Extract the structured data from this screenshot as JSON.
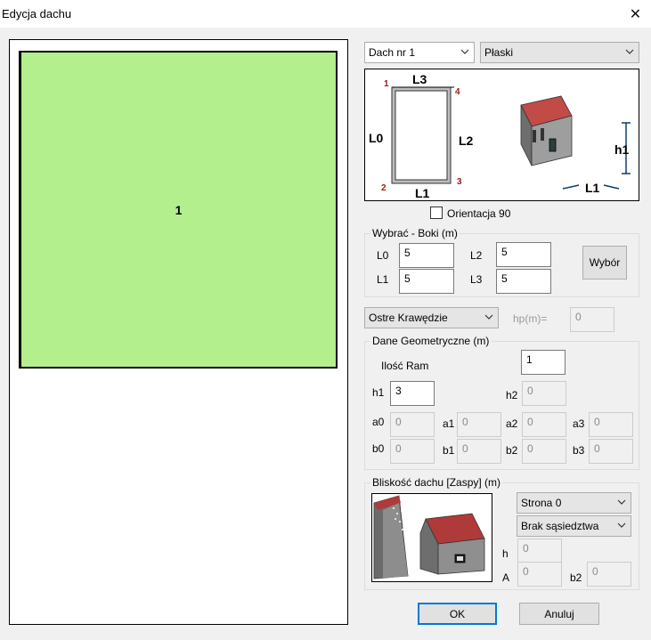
{
  "window": {
    "title": "Edycja dachu",
    "close_glyph": "✕"
  },
  "canvas": {
    "roof_label": "1"
  },
  "top": {
    "roof_select": "Dach nr 1",
    "type_select": "Płaski"
  },
  "diagram": {
    "n1": "1",
    "n2": "2",
    "n3": "3",
    "n4": "4",
    "L0": "L0",
    "L1": "L1",
    "L2": "L2",
    "L3": "L3",
    "h1": "h1",
    "L1_3d": "L1"
  },
  "orientation": {
    "label": "Orientacja 90",
    "checked": false
  },
  "sides": {
    "legend": "Wybrać - Boki (m)",
    "L0_label": "L0",
    "L0_value": "5",
    "L1_label": "L1",
    "L1_value": "5",
    "L2_label": "L2",
    "L2_value": "5",
    "L3_label": "L3",
    "L3_value": "5",
    "select_button": "Wybór"
  },
  "edges": {
    "select": "Ostre Krawędzie",
    "hp_label": "hp(m)=",
    "hp_value": "0"
  },
  "geometry": {
    "legend": "Dane Geometryczne (m)",
    "frames_label": "Ilość Ram",
    "frames_value": "1",
    "h1_label": "h1",
    "h1_value": "3",
    "h2_label": "h2",
    "h2_value": "0",
    "a0_label": "a0",
    "a0_value": "0",
    "a1_label": "a1",
    "a1_value": "0",
    "a2_label": "a2",
    "a2_value": "0",
    "a3_label": "a3",
    "a3_value": "0",
    "b0_label": "b0",
    "b0_value": "0",
    "b1_label": "b1",
    "b1_value": "0",
    "b2_label": "b2",
    "b2_value": "0",
    "b3_label": "b3",
    "b3_value": "0"
  },
  "proximity": {
    "legend": "Bliskość dachu [Zaspy] (m)",
    "side_select": "Strona 0",
    "neighbor_select": "Brak sąsiedztwa",
    "h_label": "h",
    "h_value": "0",
    "A_label": "A",
    "A_value": "0",
    "b2_label": "b2",
    "b2_value": "0"
  },
  "footer": {
    "ok": "OK",
    "cancel": "Anuluj"
  },
  "colors": {
    "roof_fill": "#b4ef8e",
    "number_red": "#a11a1a",
    "roof_red": "#b03a3a",
    "accent": "#0078d7"
  }
}
